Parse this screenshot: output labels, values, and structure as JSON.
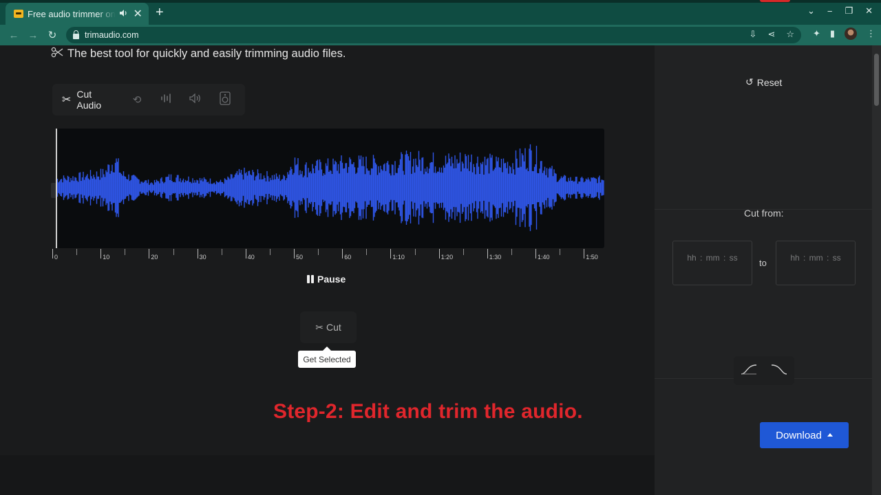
{
  "browser": {
    "tab_title": "Free audio trimmer online",
    "tab_audio_icon": "speaker-icon",
    "tab_close": "✕",
    "new_tab": "+",
    "url": "trimaudio.com",
    "window_controls": {
      "minimize": "−",
      "maximize": "❐",
      "close": "✕",
      "tab_list": "⌄"
    },
    "nav": {
      "back": "←",
      "forward": "→",
      "reload": "↻"
    },
    "omni_icons": {
      "install": "⇩",
      "share": "⋖",
      "bookmark": "☆"
    },
    "ext_icons": {
      "extensions": "✦",
      "side_panel": "▮",
      "menu": "⋮"
    }
  },
  "page": {
    "headline": "The best tool for quickly and easily trimming audio files.",
    "headline_icon": "scissors-icon",
    "tools": {
      "cut_audio_label": "Cut Audio",
      "cut_icon": "✂",
      "speed_icon": "⟲",
      "eq_icon": "⦙",
      "volume_icon": "🔉",
      "speaker_icon": "◎"
    },
    "ruler": {
      "labels": [
        "0",
        "10",
        "20",
        "30",
        "40",
        "50",
        "60",
        "1:10",
        "1:20",
        "1:30",
        "1:40",
        "1:50"
      ]
    },
    "pause_label": "Pause",
    "cut_label": "Cut",
    "cut_icon": "✂",
    "tooltip": "Get Selected",
    "caption": "Step-2: Edit and trim the audio.",
    "waveform_color": "#2f56e8"
  },
  "sidebar": {
    "reset_label": "Reset",
    "reset_icon": "↺",
    "cut_from_label": "Cut from:",
    "time_placeholder": "hh : mm : ss",
    "to_label": "to",
    "fade_in_icon": "fade-in-icon",
    "fade_out_icon": "fade-out-icon",
    "download_label": "Download",
    "download_color": "#1f58d6"
  }
}
